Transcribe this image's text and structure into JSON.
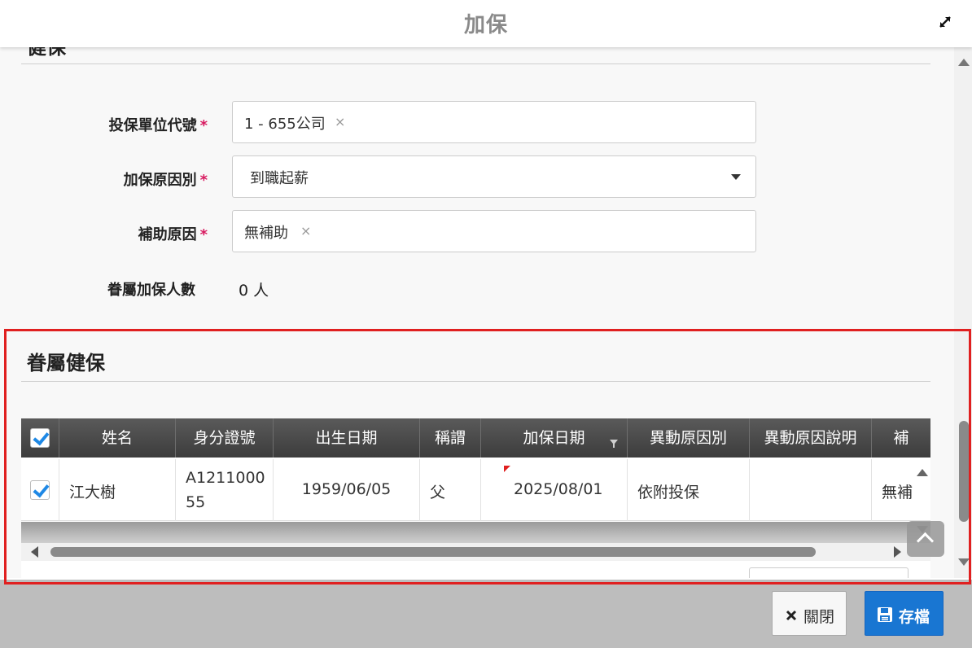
{
  "dialog": {
    "title": "加保"
  },
  "previous_section": {
    "title": "健保"
  },
  "form": {
    "unit": {
      "label": "投保單位代號",
      "required_mark": "*",
      "value": "1 - 655公司",
      "clear": "×"
    },
    "reason": {
      "label": "加保原因別",
      "required_mark": "*",
      "value": "到職起薪"
    },
    "subsidy": {
      "label": "補助原因",
      "required_mark": "*",
      "value": "無補助",
      "clear": "×"
    },
    "dependents": {
      "label": "眷屬加保人數",
      "value": "0 人"
    }
  },
  "dependents_section": {
    "title": "眷屬健保",
    "columns": [
      "姓名",
      "身分證號",
      "出生日期",
      "稱謂",
      "加保日期",
      "異動原因別",
      "異動原因說明",
      "補"
    ],
    "rows": [
      {
        "checked": true,
        "name": "江大樹",
        "id_line1": "A1211000",
        "id_line2": "55",
        "birth": "1959/06/05",
        "title": "父",
        "join_date": "2025/08/01",
        "change_reason": "依附投保",
        "change_desc": "",
        "subsidy": "無補"
      }
    ]
  },
  "footer": {
    "close_label": "關閉",
    "save_label": "存檔"
  },
  "colors": {
    "accent": "#1976d2",
    "required": "#d81b60",
    "highlight": "#e02020",
    "header_dark": "#444444"
  }
}
